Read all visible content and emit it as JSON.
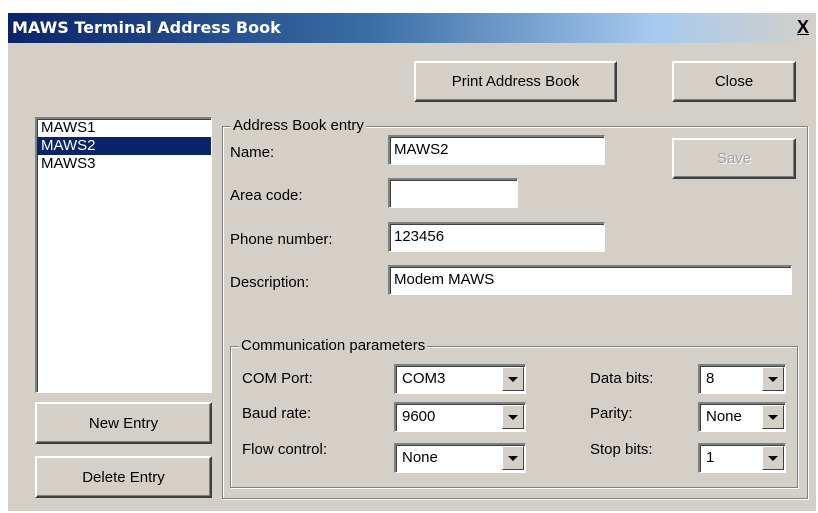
{
  "window": {
    "title": "MAWS Terminal Address Book",
    "close_glyph": "X"
  },
  "buttons": {
    "print": "Print Address Book",
    "close": "Close",
    "save": "Save",
    "new_entry": "New Entry",
    "delete_entry": "Delete Entry"
  },
  "entries": {
    "items": [
      "MAWS1",
      "MAWS2",
      "MAWS3"
    ],
    "selected": "MAWS2"
  },
  "entry": {
    "group_label": "Address Book entry",
    "name_label": "Name:",
    "name_value": "MAWS2",
    "area_code_label": "Area code:",
    "area_code_value": "",
    "phone_label": "Phone number:",
    "phone_value": "123456",
    "description_label": "Description:",
    "description_value": "Modem MAWS"
  },
  "comm": {
    "group_label": "Communication parameters",
    "com_port_label": "COM Port:",
    "com_port_value": "COM3",
    "baud_rate_label": "Baud rate:",
    "baud_rate_value": "9600",
    "flow_control_label": "Flow control:",
    "flow_control_value": "None",
    "data_bits_label": "Data bits:",
    "data_bits_value": "8",
    "parity_label": "Parity:",
    "parity_value": "None",
    "stop_bits_label": "Stop bits:",
    "stop_bits_value": "1"
  }
}
